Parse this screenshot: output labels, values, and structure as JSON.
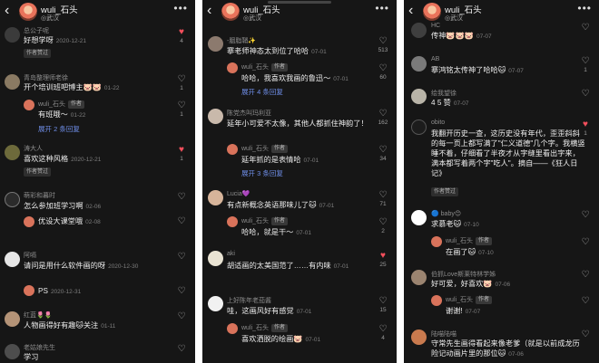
{
  "header": {
    "back_icon": "chevron-left-icon",
    "username": "wuli_石头",
    "location": "◎武汉",
    "more_icon": "ellipsis-icon"
  },
  "author_tag": "作者",
  "liked_by_author": "作者赞过",
  "panel1": [
    {
      "name": "总公子呢",
      "text": "好想学呀",
      "time": "2020-12-21",
      "likes": "4",
      "liked": true
    },
    {
      "name": "青岛整理师老徐",
      "text": "开个培训班吧博主🐷🐷",
      "time": "01-22",
      "likes": "1"
    },
    {
      "reply": true,
      "name": "wuli_石头",
      "text": "有班哦～",
      "time": "01-22",
      "likes": "1"
    },
    {
      "more": "展开 2 条回复"
    },
    {
      "name": "涛大人",
      "text": "喜欢这种风格",
      "time": "2020-12-21",
      "likes": "1",
      "liked": true
    },
    {
      "name": "萌彩和暮时",
      "text": "怎么参加班学习啊",
      "time": "02-06",
      "likes": ""
    },
    {
      "reply": true,
      "name": "wuli_石头",
      "text": "优设大课堂哦",
      "time": "02-08",
      "likes": ""
    },
    {
      "name": "阿嗝",
      "text": "请问是用什么软件画的呀",
      "time": "2020-12-30",
      "likes": ""
    },
    {
      "reply": true,
      "name": "wuli_石头",
      "text": "PS",
      "time": "2020-12-31",
      "likes": ""
    },
    {
      "name": "红蓝🌷🌷",
      "text": "人物画得好有趣🐱关注",
      "time": "01-11",
      "likes": ""
    },
    {
      "name": "老姑娘先生",
      "text": "学习",
      "time": "01-15",
      "likes": ""
    }
  ],
  "panel2": [
    {
      "name": "-胭脂鞘✨",
      "text": "搴老师神态太到位了哈哈",
      "time": "07-01",
      "likes": "513"
    },
    {
      "reply": true,
      "name": "wuli_石头",
      "text": "哈哈，我喜欢我画的鲁迅～",
      "time": "07-01",
      "likes": "60"
    },
    {
      "more": "展开 4 条回复"
    },
    {
      "name": "陈党杰叫玛利亚",
      "text": "延年小可爱不太像，其他人都抓住神韵了！",
      "time": "",
      "likes": "162"
    },
    {
      "reply": true,
      "name": "wuli_石头",
      "text": "延年抓的是表情哈",
      "time": "07-01",
      "likes": "34"
    },
    {
      "more": "展开 3 条回复"
    },
    {
      "name": "Lucia💜",
      "text": "有点新概念英语那味儿了🐱",
      "time": "07-01",
      "likes": "71"
    },
    {
      "reply": true,
      "name": "wuli_石头",
      "text": "哈哈，就是干～",
      "time": "07-01",
      "likes": "2"
    },
    {
      "name": "aki",
      "text": "胡适画的太美国范了……有内味",
      "time": "07-01",
      "likes": "25",
      "liked": true
    },
    {
      "name": "上好陈年老茄酱",
      "text": "哇，这画风好有感觉",
      "time": "07-01",
      "likes": "15"
    },
    {
      "reply": true,
      "name": "wuli_石头",
      "text": "喜欢洒脱的绘画🐷",
      "time": "07-01",
      "likes": "4"
    }
  ],
  "panel3": [
    {
      "name": "HC",
      "text": "传神🐷🐷🐷",
      "time": "07-07",
      "likes": ""
    },
    {
      "name": "AB",
      "text": "搴鸿铭太传神了哈哈🐱",
      "time": "07-07",
      "likes": "1"
    },
    {
      "name": "绘我望徐",
      "text": "4 5 赞",
      "time": "07-07",
      "likes": ""
    },
    {
      "name": "obito",
      "text": "我翻开历史一查，这历史没有年代，歪歪斜斜的每一页上都写满了\"仁义道德\"几个字。我横竖睡不着，仔细看了半夜才从字缝里看出字来，满本都写着两个字\"吃人\"。摘自——《狂人日记》",
      "time": "",
      "likes": "1",
      "liked": true
    },
    {
      "name": "🔵 baby😊",
      "text": "求慕老🐱",
      "time": "07-10",
      "likes": ""
    },
    {
      "reply": true,
      "name": "wuli_石头",
      "text": "在画了🐱",
      "time": "07-10",
      "likes": ""
    },
    {
      "name": "伯抓Love斯莱特林学姊",
      "text": "好可爱，好喜欢🐷",
      "time": "07-06",
      "likes": ""
    },
    {
      "reply": true,
      "name": "wuli_石头",
      "text": "谢谢!",
      "time": "07-07",
      "likes": ""
    },
    {
      "name": "陆喵陆喵",
      "text": "守常先生画得看起来像老爹（就是以前成龙历险记动画片里的那位🐱",
      "time": "07-06",
      "likes": ""
    }
  ]
}
